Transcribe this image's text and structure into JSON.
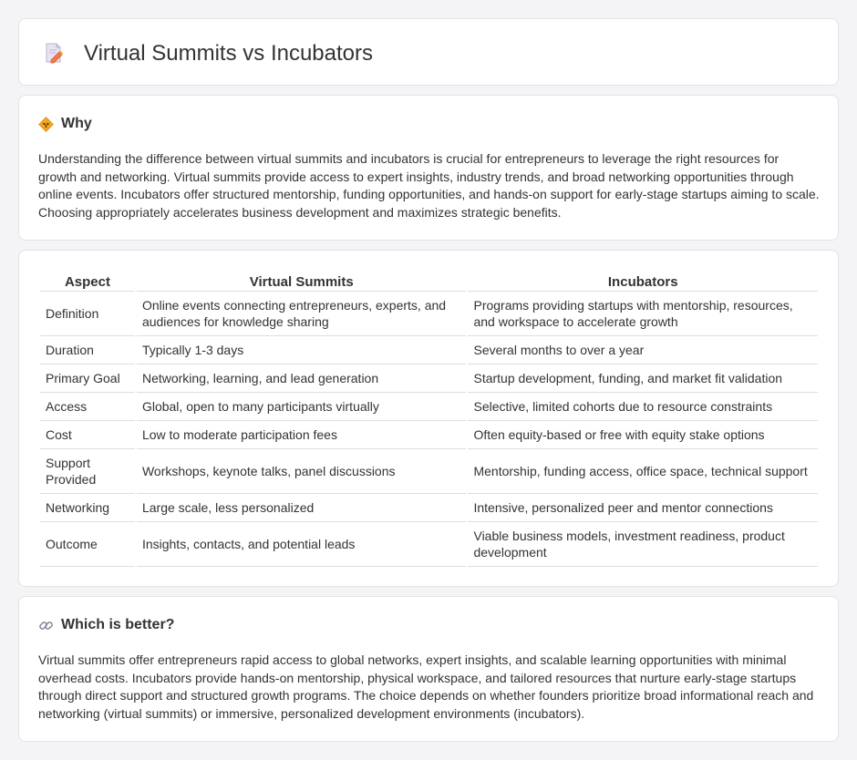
{
  "header": {
    "title": "Virtual Summits vs Incubators",
    "icon": "document-pencil-icon"
  },
  "why": {
    "icon": "diamond-sign-icon",
    "title": "Why",
    "text": "Understanding the difference between virtual summits and incubators is crucial for entrepreneurs to leverage the right resources for growth and networking. Virtual summits provide access to expert insights, industry trends, and broad networking opportunities through online events. Incubators offer structured mentorship, funding opportunities, and hands-on support for early-stage startups aiming to scale. Choosing appropriately accelerates business development and maximizes strategic benefits."
  },
  "table": {
    "headers": [
      "Aspect",
      "Virtual Summits",
      "Incubators"
    ],
    "rows": [
      [
        "Definition",
        "Online events connecting entrepreneurs, experts, and audiences for knowledge sharing",
        "Programs providing startups with mentorship, resources, and workspace to accelerate growth"
      ],
      [
        "Duration",
        "Typically 1-3 days",
        "Several months to over a year"
      ],
      [
        "Primary Goal",
        "Networking, learning, and lead generation",
        "Startup development, funding, and market fit validation"
      ],
      [
        "Access",
        "Global, open to many participants virtually",
        "Selective, limited cohorts due to resource constraints"
      ],
      [
        "Cost",
        "Low to moderate participation fees",
        "Often equity-based or free with equity stake options"
      ],
      [
        "Support Provided",
        "Workshops, keynote talks, panel discussions",
        "Mentorship, funding access, office space, technical support"
      ],
      [
        "Networking",
        "Large scale, less personalized",
        "Intensive, personalized peer and mentor connections"
      ],
      [
        "Outcome",
        "Insights, contacts, and potential leads",
        "Viable business models, investment readiness, product development"
      ]
    ]
  },
  "better": {
    "icon": "link-icon",
    "title": "Which is better?",
    "text": "Virtual summits offer entrepreneurs rapid access to global networks, expert insights, and scalable learning opportunities with minimal overhead costs. Incubators provide hands-on mentorship, physical workspace, and tailored resources that nurture early-stage startups through direct support and structured growth programs. The choice depends on whether founders prioritize broad informational reach and networking (virtual summits) or immersive, personalized development environments (incubators)."
  }
}
